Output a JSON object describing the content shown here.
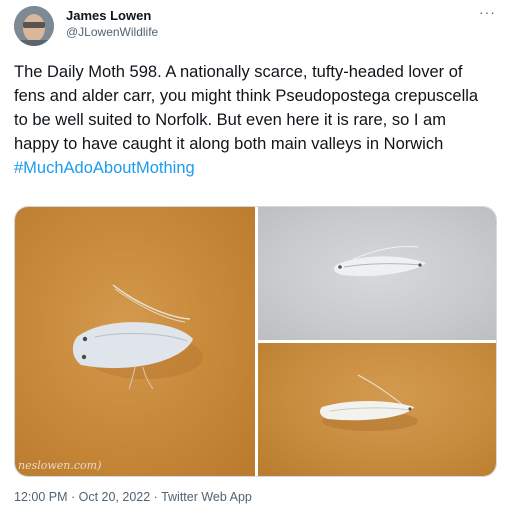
{
  "author": {
    "name": "James Lowen",
    "handle": "@JLowenWildlife"
  },
  "more_icon": "···",
  "tweet": {
    "text": "The Daily Moth 598. A nationally scarce, tufty-headed lover of fens and alder carr, you might think Pseudopostega crepuscella to be well suited to Norfolk. But even here it is rare, so I am happy to have caught it along both main valleys in Norwich ",
    "hashtag": "#MuchAdoAboutMothing"
  },
  "media": {
    "watermark": "neslowen.com)"
  },
  "footer": {
    "meta": "12:00 PM · Oct 20, 2022 · Twitter Web App"
  },
  "colors": {
    "link": "#1d9bf0",
    "secondary_text": "#536471"
  }
}
